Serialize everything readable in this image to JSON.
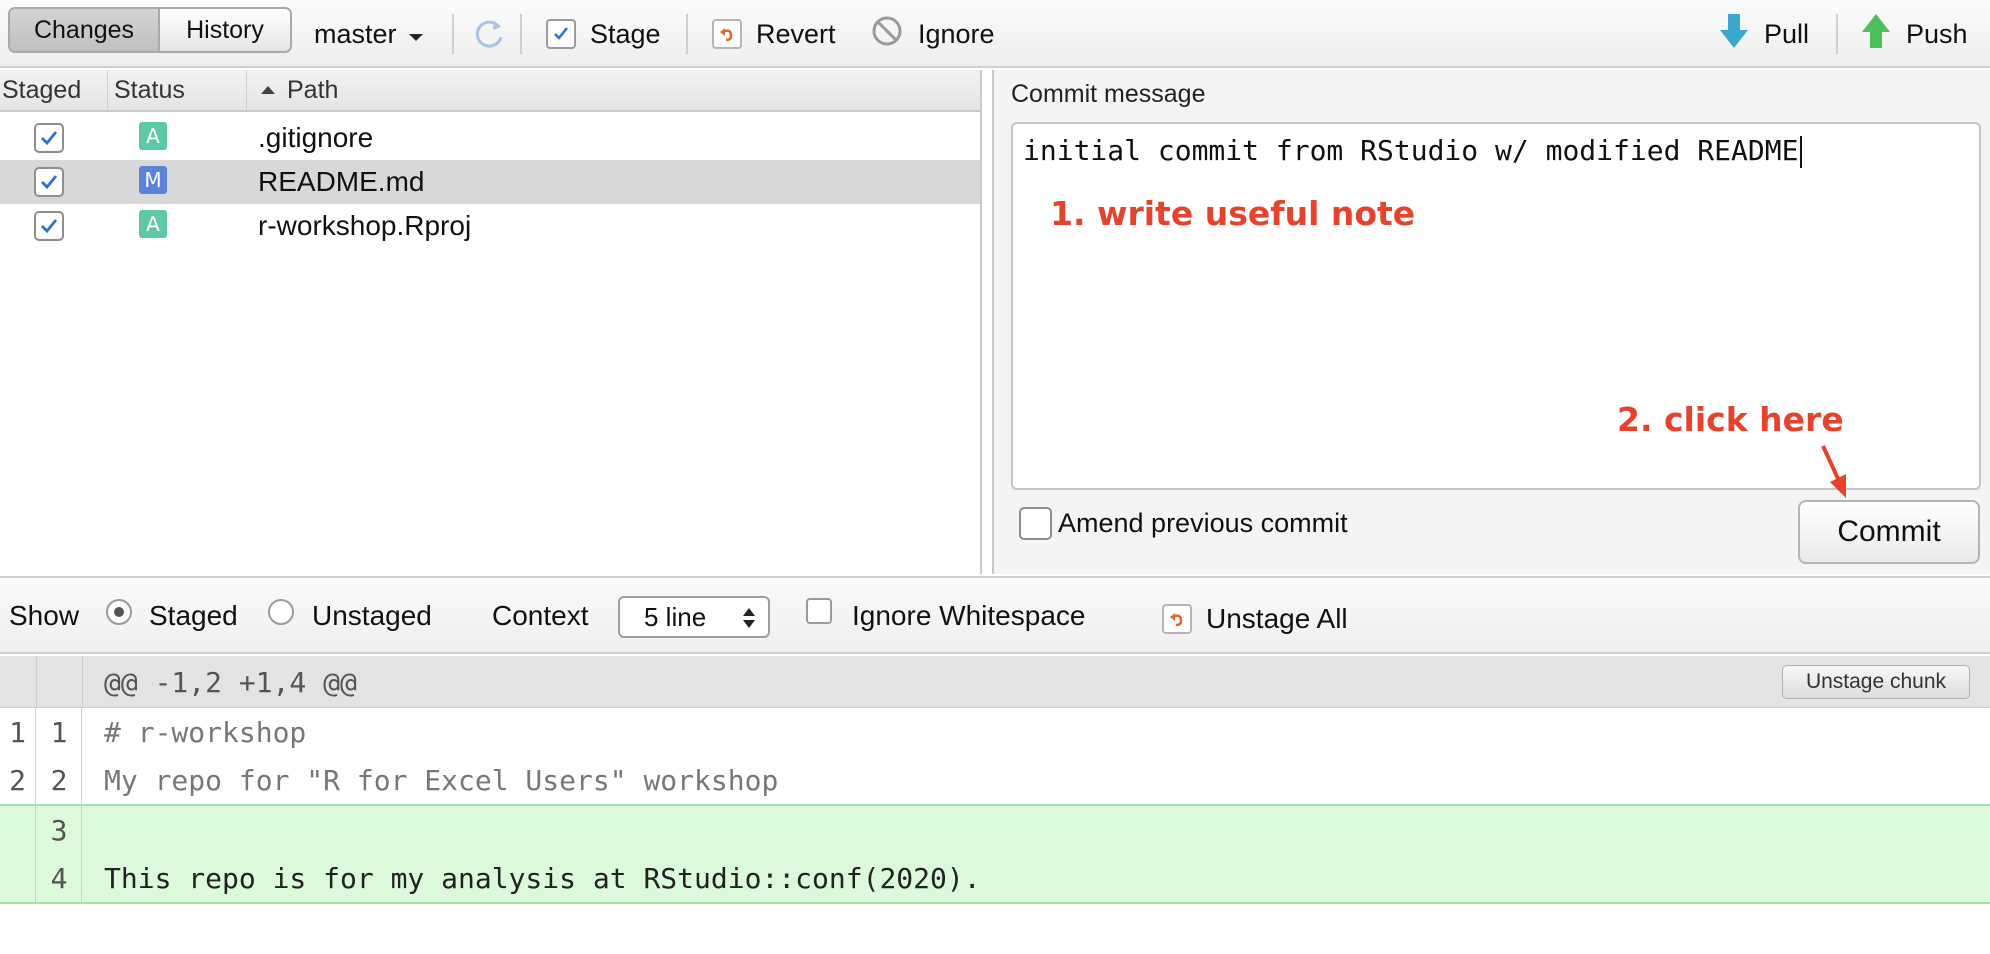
{
  "toolbar": {
    "tabs": [
      {
        "label": "Changes",
        "active": true
      },
      {
        "label": "History",
        "active": false
      }
    ],
    "branch": "master",
    "stage_label": "Stage",
    "revert_label": "Revert",
    "ignore_label": "Ignore",
    "pull_label": "Pull",
    "push_label": "Push"
  },
  "file_list": {
    "columns": [
      "Staged",
      "Status",
      "Path"
    ],
    "sort_column": "Path",
    "rows": [
      {
        "staged": true,
        "status": "A",
        "path": ".gitignore",
        "selected": false
      },
      {
        "staged": true,
        "status": "M",
        "path": "README.md",
        "selected": true
      },
      {
        "staged": true,
        "status": "A",
        "path": "r-workshop.Rproj",
        "selected": false
      }
    ]
  },
  "commit": {
    "label": "Commit message",
    "message": "initial commit from RStudio w/ modified README",
    "amend_label": "Amend previous commit",
    "amend_checked": false,
    "button_label": "Commit"
  },
  "annotations": {
    "note1": "1. write useful note",
    "note2": "2. click here",
    "color": "#e5432b"
  },
  "diff_options": {
    "show_label": "Show",
    "staged_label": "Staged",
    "unstaged_label": "Unstaged",
    "selected_view": "Staged",
    "context_label": "Context",
    "context_value": "5 line",
    "ignore_ws_label": "Ignore Whitespace",
    "ignore_ws_checked": false,
    "unstage_all_label": "Unstage All"
  },
  "diff": {
    "hunk_header": "@@ -1,2 +1,4 @@",
    "unstage_chunk_label": "Unstage chunk",
    "lines": [
      {
        "old": "1",
        "new": "1",
        "type": "context",
        "text": "# r-workshop"
      },
      {
        "old": "2",
        "new": "2",
        "type": "context",
        "text": "My repo for \"R for Excel Users\" workshop"
      },
      {
        "old": "",
        "new": "3",
        "type": "added",
        "text": ""
      },
      {
        "old": "",
        "new": "4",
        "type": "added",
        "text": "This repo is for my analysis at RStudio::conf(2020)."
      }
    ]
  },
  "colors": {
    "added_bg": "#dcfadb",
    "badge_added": "#5ec9a6",
    "badge_modified": "#5b83d9",
    "check": "#2f6fcf"
  }
}
